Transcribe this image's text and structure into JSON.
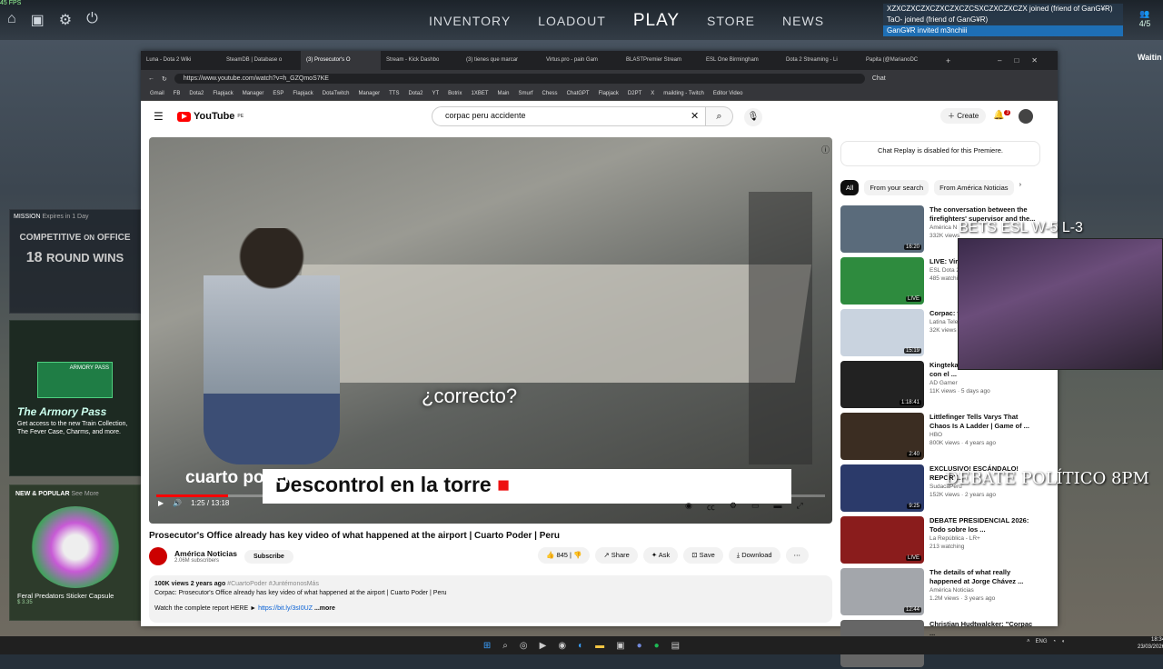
{
  "game": {
    "fps": "45 FPS",
    "nav": [
      "INVENTORY",
      "LOADOUT",
      "PLAY",
      "STORE",
      "NEWS"
    ],
    "notifications": [
      "XZXCZXCZXCZXCZXCZCSXCZXCZXCZX joined (friend of GanG¥R)",
      "TaO- joined (friend of GanG¥R)",
      "GanG¥R invited m3nchiii"
    ],
    "party_count": "4/5",
    "waiting": "Waitin",
    "mission": {
      "label": "MISSION",
      "expires": "Expires in 1 Day",
      "title": "COMPETITIVE",
      "on": "OFFICE",
      "wins": "18",
      "wins_label": "ROUND WINS"
    },
    "armory": {
      "badge": "ARMORY PASS",
      "title": "The Armory Pass",
      "desc": "Get access to the new Train Collection, The Fever Case, Charms, and more."
    },
    "popular": {
      "label": "NEW & POPULAR",
      "sub": "See More",
      "item": "Feral Predators Sticker Capsule",
      "price": "$ 3.35"
    }
  },
  "browser": {
    "tabs": [
      "Luna - Dota 2 Wiki",
      "SteamDB | Database o",
      "(3) Prosecutor's O",
      "Stream - Kick Dashbo",
      "(3) tienes que marcar",
      "Virtus.pro - pain Gam",
      "BLASTPremier Stream",
      "ESL One Birmingham",
      "Dota 2 Streaming - Li",
      "Papita (@MarianoDC"
    ],
    "url": "https://www.youtube.com/watch?v=h_GZQmoS7KE",
    "bookmarks": [
      "Gmail",
      "FB",
      "Dota2",
      "Flapjack",
      "Manager",
      "ESP",
      "Flapjack",
      "DotaTwitch",
      "Manager",
      "TTS",
      "Dota2",
      "YT",
      "Botrix",
      "1XBET",
      "Main",
      "Smurf",
      "Chess",
      "ChatGPT",
      "Flapjack",
      "D2PT",
      "X",
      "mailding - Twitch",
      "Editor Video"
    ]
  },
  "yt": {
    "logo": "YouTube",
    "region": "PE",
    "search": "corpac peru accidente",
    "create": "Create",
    "bell_count": "3",
    "video": {
      "subtitle": "¿correcto?",
      "lower_third": "Descontrol en la torre",
      "brand": "cuarto poder",
      "time": "1:25 / 13:18",
      "progress": 0.107
    },
    "title": "Prosecutor's Office already has key video of what happened at the airport | Cuarto Poder | Peru",
    "channel": "América Noticias",
    "subs": "2.06M subscribers",
    "subscribe": "Subscribe",
    "likes": "845",
    "share": "Share",
    "ask": "Ask",
    "save": "Save",
    "download": "Download",
    "desc": {
      "meta": "100K views  2 years ago",
      "tags": "#CuartoPoder #JuntémonosMás",
      "line1": "Corpac: Prosecutor's Office already has key video of what happened at the airport | Cuarto Poder | Peru",
      "line2": "Watch the complete report HERE ►",
      "link": "https://bit.ly/3sI0UZ",
      "more": "...more"
    },
    "chat_replay": "Chat Replay is disabled for this Premiere.",
    "chips": [
      "All",
      "From your search",
      "From América Noticias"
    ],
    "recs": [
      {
        "title": "The conversation between the firefighters' supervisor and the...",
        "channel": "América N",
        "meta": "332K views",
        "dur": "16:20",
        "color": "#5a6b7b"
      },
      {
        "title": "LIVE: Virtus.pro vs... Gaming",
        "channel": "ESL Dota 2",
        "meta": "485 watching",
        "dur": "LIVE",
        "color": "#2e8b3e"
      },
      {
        "title": "Corpac: tienen su...",
        "channel": "Latina Tele",
        "meta": "32K views",
        "dur": "15:19",
        "color": "#c9d3df"
      },
      {
        "title": "Kingteka 100K, cuenta qué pasó con el ...",
        "channel": "AD Gamer",
        "meta": "11K views · 5 days ago",
        "dur": "1:18:41",
        "color": "#222"
      },
      {
        "title": "Littlefinger Tells Varys That Chaos Is A Ladder | Game of ...",
        "channel": "HBO",
        "meta": "800K views · 4 years ago",
        "dur": "2:40",
        "color": "#3b2d22"
      },
      {
        "title": "EXCLUSIVO! ESCÁNDALO! REPORT...",
        "channel": "SudacaPeru",
        "meta": "152K views · 2 years ago",
        "dur": "9:25",
        "color": "#2b3a6a"
      },
      {
        "title": "DEBATE PRESIDENCIAL 2026: Todo sobre los ...",
        "channel": "La República - LR+",
        "meta": "213 watching",
        "dur": "LIVE",
        "color": "#8a1c1c"
      },
      {
        "title": "The details of what really happened at Jorge Chávez ...",
        "channel": "América Noticias",
        "meta": "1.2M views · 3 years ago",
        "dur": "12:44",
        "color": "#a3a6ab"
      },
      {
        "title": "Christian Hudtwalcker: \"Corpac ...",
        "channel": "",
        "meta": "",
        "dur": "",
        "color": "#666"
      }
    ]
  },
  "overlay": {
    "bets": "BETS ESL W-5 L-3",
    "debate": "DEBATE POLÍTICO 8PM"
  },
  "taskbar": {
    "lang": "ENG",
    "time": "18:34",
    "date": "23/03/2026"
  }
}
